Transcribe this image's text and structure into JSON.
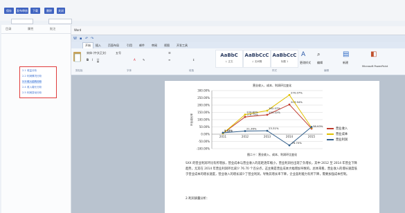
{
  "toolbar": {
    "buttons": [
      "保存",
      "发布审核",
      "下载",
      "删除",
      "关闭"
    ]
  },
  "subbar": {
    "labels": [
      "",
      ""
    ],
    "select": ""
  },
  "left_panel": {
    "tabs": [
      "目录",
      "属性",
      "批注"
    ],
    "root": "",
    "items": [
      "2.1 收益分析",
      "2.2 利润情况分析",
      "2.3 收入结构分析",
      "2.4 收入增长分析",
      "2.5 利润变动分析"
    ]
  },
  "app": {
    "title": "Word",
    "menus": [
      "开始",
      "插入",
      "页面布局",
      "引用",
      "邮件",
      "审阅",
      "视图",
      "开发工具"
    ],
    "ribbon": {
      "font_name": "宋体 (中文正文)",
      "font_size": "五号",
      "styles": [
        {
          "sample": "AaBbC",
          "name": "↓ 正文"
        },
        {
          "sample": "AaBbCcC",
          "name": "↓ 无间隔"
        },
        {
          "sample": "AaBbCcC",
          "name": "标题 1"
        }
      ],
      "change_styles": "更改样式",
      "edit": "编辑",
      "new_label": "新建",
      "ppt_label": "Microsoft PowerPoint",
      "groups": [
        "剪贴板",
        "字体",
        "段落",
        "样式",
        "编辑"
      ]
    }
  },
  "document": {
    "chart_caption": "图二十：营业收入、成本、利润环比变化",
    "paragraph1": "SXX 的营业利润环比有所增加，营业成本与营业收入的差距逐年缩小，营业利润也出现了负增长，其中 2012 至 2014 年营业下降趋势，尤其在 2014 年营业利润环比减少 76.70 个百分点，这主要是营业成本大幅增加导致的。总体来看，营业收入的增长速度低于营业成本的增长速度，营业收入的增长减少了营业利润，导致其增长率下降，企业盈利能力有所下降，需要加强成本控制。",
    "paragraph2": "2.利润质量分析："
  },
  "chart_data": {
    "type": "line",
    "title": "营业收入、成本、利润环比变化",
    "categories": [
      "2011",
      "2012",
      "2013",
      "2014",
      "2015"
    ],
    "ylim": [
      -100,
      300
    ],
    "ytick_labels": [
      "300.00%",
      "250.00%",
      "200.00%",
      "150.00%",
      "100.00%",
      "50.00%",
      "0.00%",
      "-50.00%",
      "-100.00%"
    ],
    "ylabel": "环比增长率",
    "series": [
      {
        "name": "营业收入",
        "color": "#c0392b",
        "values": [
          5.2,
          118.73,
          133.22,
          203.94,
          38.93
        ],
        "labels": [
          "",
          "118.73%",
          "133.22%",
          "203.94%",
          "38.93%"
        ]
      },
      {
        "name": "营业成本",
        "color": "#e0c000",
        "values": [
          4.58,
          134.82,
          162.07,
          270.07,
          45.14
        ],
        "labels": [
          "4.58%",
          "134.82%",
          "162.07%",
          "270.07%",
          ""
        ]
      },
      {
        "name": "营业利润",
        "color": "#2f5d8a",
        "values": [
          9.77,
          21.36,
          23.31,
          -76.7,
          50.1
        ],
        "labels": [
          "9.77%",
          "21.36%",
          "23.31%",
          "-76.70%",
          ""
        ]
      }
    ],
    "legend_position": "right",
    "grid": true
  }
}
